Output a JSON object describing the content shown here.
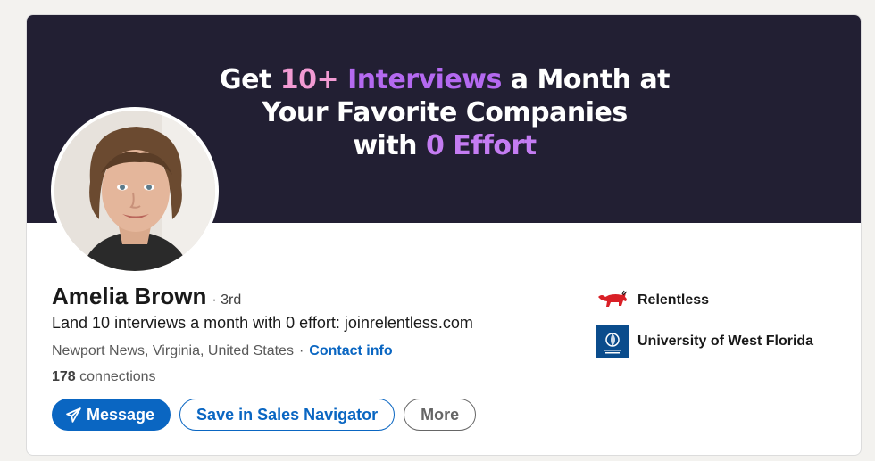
{
  "banner": {
    "line1_a": "Get ",
    "line1_b": "10+ ",
    "line1_c": "Interviews",
    "line1_d": " a Month at",
    "line2": "Your Favorite Companies",
    "line3_a": "with ",
    "line3_b": "0 Effort"
  },
  "profile": {
    "name": "Amelia Brown",
    "degree": "· 3rd",
    "headline": "Land 10 interviews a month with 0 effort: joinrelentless.com",
    "location": "Newport News, Virginia, United States",
    "separator": "·",
    "contact_info": "Contact info",
    "connections_count": "178",
    "connections_label": " connections"
  },
  "actions": {
    "message": "Message",
    "save_sales_nav": "Save in Sales Navigator",
    "more": "More"
  },
  "organizations": [
    {
      "name": "Relentless",
      "icon": "bull-logo-icon"
    },
    {
      "name": "University of West Florida",
      "icon": "uwf-logo-icon"
    }
  ],
  "colors": {
    "brand_blue": "#0a66c2",
    "banner_bg": "#221f33",
    "page_bg": "#f3f2ef"
  }
}
